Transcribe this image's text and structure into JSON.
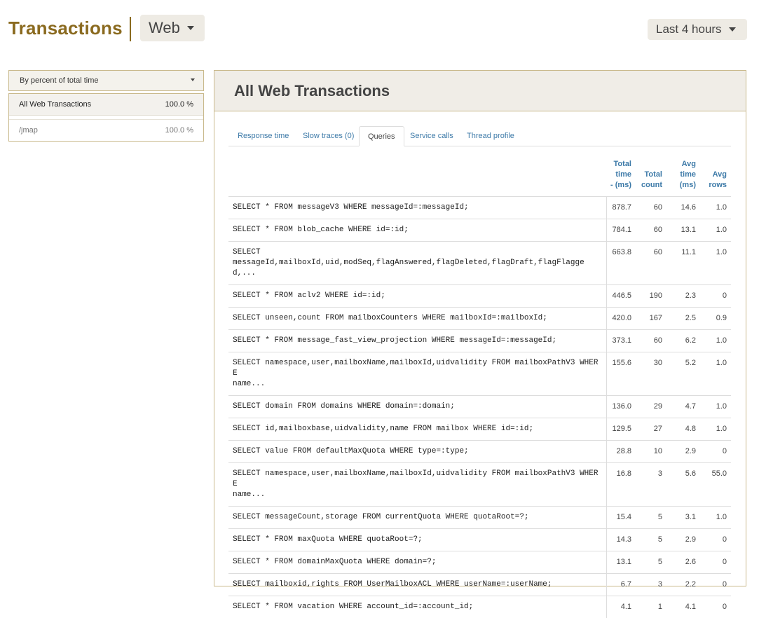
{
  "header": {
    "title": "Transactions",
    "type_selector": "Web",
    "time_range": "Last 4 hours"
  },
  "sidebar": {
    "sort_by": "By percent of total time",
    "items": [
      {
        "name": "All Web Transactions",
        "value": "100.0 %"
      },
      {
        "name": "/jmap",
        "value": "100.0 %"
      }
    ]
  },
  "panel": {
    "title": "All Web Transactions",
    "tabs": [
      "Response time",
      "Slow traces (0)",
      "Queries",
      "Service calls",
      "Thread profile"
    ],
    "active_tab": "Queries",
    "columns": {
      "total_time": [
        "Total",
        "time",
        "- (ms)"
      ],
      "total_count": [
        "Total",
        "count"
      ],
      "avg_time": [
        "Avg",
        "time",
        "(ms)"
      ],
      "avg_rows": [
        "Avg",
        "rows"
      ]
    },
    "rows": [
      {
        "query": "SELECT * FROM messageV3 WHERE messageId=:messageId;",
        "total_time": "878.7",
        "total_count": "60",
        "avg_time": "14.6",
        "avg_rows": "1.0"
      },
      {
        "query": "SELECT * FROM blob_cache WHERE id=:id;",
        "total_time": "784.1",
        "total_count": "60",
        "avg_time": "13.1",
        "avg_rows": "1.0"
      },
      {
        "query": "SELECT\nmessageId,mailboxId,uid,modSeq,flagAnswered,flagDeleted,flagDraft,flagFlagged,...",
        "total_time": "663.8",
        "total_count": "60",
        "avg_time": "11.1",
        "avg_rows": "1.0"
      },
      {
        "query": "SELECT * FROM aclv2 WHERE id=:id;",
        "total_time": "446.5",
        "total_count": "190",
        "avg_time": "2.3",
        "avg_rows": "0"
      },
      {
        "query": "SELECT unseen,count FROM mailboxCounters WHERE mailboxId=:mailboxId;",
        "total_time": "420.0",
        "total_count": "167",
        "avg_time": "2.5",
        "avg_rows": "0.9"
      },
      {
        "query": "SELECT * FROM message_fast_view_projection WHERE messageId=:messageId;",
        "total_time": "373.1",
        "total_count": "60",
        "avg_time": "6.2",
        "avg_rows": "1.0"
      },
      {
        "query": "SELECT namespace,user,mailboxName,mailboxId,uidvalidity FROM mailboxPathV3 WHERE\nname...",
        "total_time": "155.6",
        "total_count": "30",
        "avg_time": "5.2",
        "avg_rows": "1.0"
      },
      {
        "query": "SELECT domain FROM domains WHERE domain=:domain;",
        "total_time": "136.0",
        "total_count": "29",
        "avg_time": "4.7",
        "avg_rows": "1.0"
      },
      {
        "query": "SELECT id,mailboxbase,uidvalidity,name FROM mailbox WHERE id=:id;",
        "total_time": "129.5",
        "total_count": "27",
        "avg_time": "4.8",
        "avg_rows": "1.0"
      },
      {
        "query": "SELECT value FROM defaultMaxQuota WHERE type=:type;",
        "total_time": "28.8",
        "total_count": "10",
        "avg_time": "2.9",
        "avg_rows": "0"
      },
      {
        "query": "SELECT namespace,user,mailboxName,mailboxId,uidvalidity FROM mailboxPathV3 WHERE\nname...",
        "total_time": "16.8",
        "total_count": "3",
        "avg_time": "5.6",
        "avg_rows": "55.0"
      },
      {
        "query": "SELECT messageCount,storage FROM currentQuota WHERE quotaRoot=?;",
        "total_time": "15.4",
        "total_count": "5",
        "avg_time": "3.1",
        "avg_rows": "1.0"
      },
      {
        "query": "SELECT * FROM maxQuota WHERE quotaRoot=?;",
        "total_time": "14.3",
        "total_count": "5",
        "avg_time": "2.9",
        "avg_rows": "0"
      },
      {
        "query": "SELECT * FROM domainMaxQuota WHERE domain=?;",
        "total_time": "13.1",
        "total_count": "5",
        "avg_time": "2.6",
        "avg_rows": "0"
      },
      {
        "query": "SELECT mailboxid,rights FROM UserMailboxACL WHERE userName=:userName;",
        "total_time": "6.7",
        "total_count": "3",
        "avg_time": "2.2",
        "avg_rows": "0"
      },
      {
        "query": "SELECT * FROM vacation WHERE account_id=:account_id;",
        "total_time": "4.1",
        "total_count": "1",
        "avg_time": "4.1",
        "avg_rows": "0"
      }
    ]
  }
}
